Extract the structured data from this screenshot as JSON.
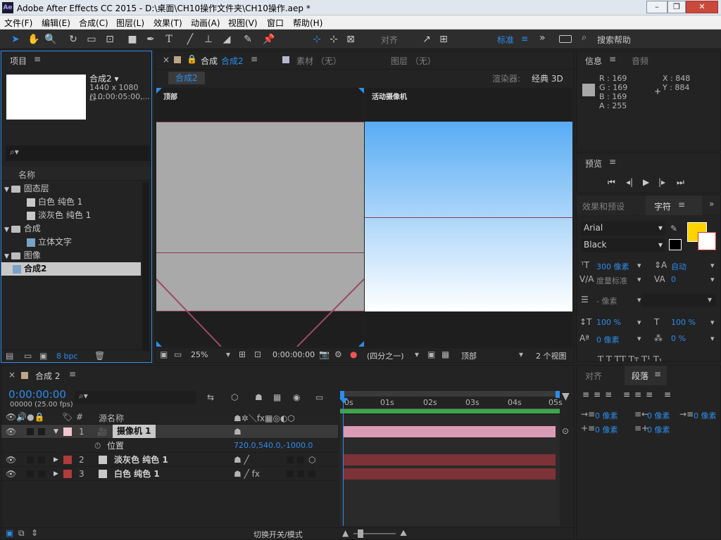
{
  "window": {
    "app_icon": "Ae",
    "title": "Adobe After Effects CC 2015 - D:\\桌面\\CH10操作文件夹\\CH10操作.aep *",
    "min": "–",
    "max": "❐",
    "close": "✕"
  },
  "menu": [
    "文件(F)",
    "编辑(E)",
    "合成(C)",
    "图层(L)",
    "效果(T)",
    "动画(A)",
    "视图(V)",
    "窗口",
    "帮助(H)"
  ],
  "toolbar": {
    "snap_label": "对齐",
    "workspace": "标准",
    "search": "搜索帮助"
  },
  "project": {
    "tab": "项目",
    "comp_name": "合成2 ▾",
    "comp_size": "1440 x 1080 (1...",
    "comp_dur": "△ 0:00:05:00,...",
    "col_name": "名称",
    "bpc": "8 bpc",
    "items": [
      {
        "label": "固态层",
        "type": "folder",
        "level": 0
      },
      {
        "label": "白色 纯色 1",
        "type": "solid",
        "level": 1
      },
      {
        "label": "淡灰色 纯色 1",
        "type": "solid",
        "level": 1
      },
      {
        "label": "合成",
        "type": "folder",
        "level": 0
      },
      {
        "label": "立体文字",
        "type": "comp",
        "level": 1
      },
      {
        "label": "图像",
        "type": "folder",
        "level": 0
      },
      {
        "label": "合成2",
        "type": "comp",
        "level": 0,
        "selected": true
      }
    ]
  },
  "viewer": {
    "tab_prefix": "合成",
    "tab_name": "合成2",
    "tab_footage": "素材 （无）",
    "tab_layer": "图层 （无）",
    "comp_badge": "合成2",
    "renderer_label": "渲染器:",
    "renderer": "经典 3D",
    "left_label": "顶部",
    "right_label": "活动摄像机",
    "zoom": "25%",
    "timecode": "0:00:00:00",
    "resolution": "(四分之一)",
    "view_select": "顶部",
    "views": "2 个视图"
  },
  "info": {
    "tab": "信息",
    "tab2": "音频",
    "r": "R : 169",
    "g": "G : 169",
    "b": "B : 169",
    "a": "A : 255",
    "x": "X : 848",
    "y": "Y : 884"
  },
  "preview": {
    "tab": "预览"
  },
  "character": {
    "tab_effects": "效果和预设",
    "tab": "字符",
    "font": "Arial",
    "style": "Black",
    "size": "300 像素",
    "leading": "自动",
    "kerning": "度量标准",
    "tracking": "0",
    "stroke": "- 像素",
    "vscale": "100 %",
    "hscale": "100 %",
    "baseline": "0 像素",
    "tsume": "0 %",
    "fill_color": "#ffd200"
  },
  "paragraph": {
    "tab_align": "对齐",
    "tab": "段落",
    "indent1": "0 像素",
    "indent2": "0 像素",
    "indent3": "0 像素",
    "space1": "0 像素",
    "space2": "0 像素"
  },
  "timeline": {
    "tab": "合成 2",
    "timecode": "0:00:00:00",
    "fps": "00000 (25.00 fps)",
    "col_num": "#",
    "col_source": "源名称",
    "ticks": [
      "0s",
      "01s",
      "02s",
      "03s",
      "04s",
      "05s"
    ],
    "toggle_label": "切换开关/模式",
    "layers": [
      {
        "num": "1",
        "name": "摄像机 1",
        "color": "#f1c5cf",
        "bar": "#dc9bb4",
        "selected": true
      },
      {
        "num": "2",
        "name": "淡灰色 纯色 1",
        "color": "#b03c3c",
        "bar": "#7d3237"
      },
      {
        "num": "3",
        "name": "白色 纯色 1",
        "color": "#b03c3c",
        "bar": "#7d3237"
      }
    ],
    "prop_label": "位置",
    "prop_value": "720.0,540.0,-1000.0"
  }
}
